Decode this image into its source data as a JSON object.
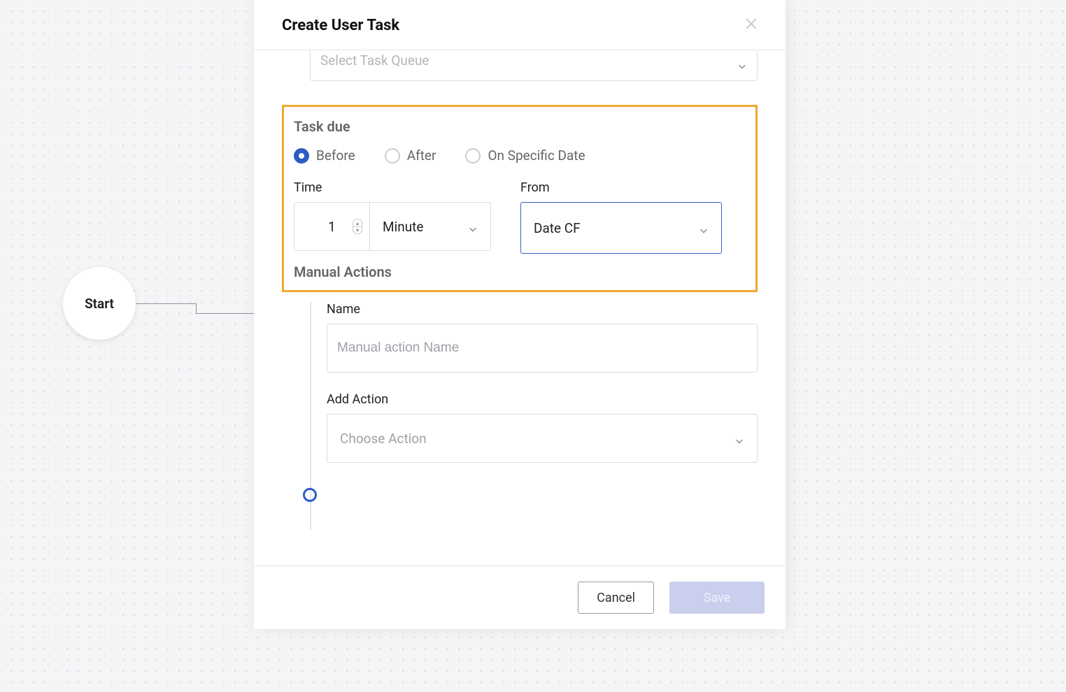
{
  "canvas": {
    "start_node_label": "Start"
  },
  "modal": {
    "title": "Create User Task",
    "queue": {
      "placeholder": "Select Task Queue"
    },
    "task_due": {
      "section_title": "Task due",
      "radio_before": "Before",
      "radio_after": "After",
      "radio_specific": "On Specific Date",
      "selected_radio": "before",
      "time_label": "Time",
      "time_value": "1",
      "time_unit": "Minute",
      "from_label": "From",
      "from_value": "Date CF"
    },
    "manual_actions": {
      "section_title": "Manual Actions",
      "name_label": "Name",
      "name_placeholder": "Manual action Name",
      "add_action_label": "Add Action",
      "add_action_placeholder": "Choose Action"
    },
    "footer": {
      "cancel": "Cancel",
      "save": "Save"
    }
  }
}
